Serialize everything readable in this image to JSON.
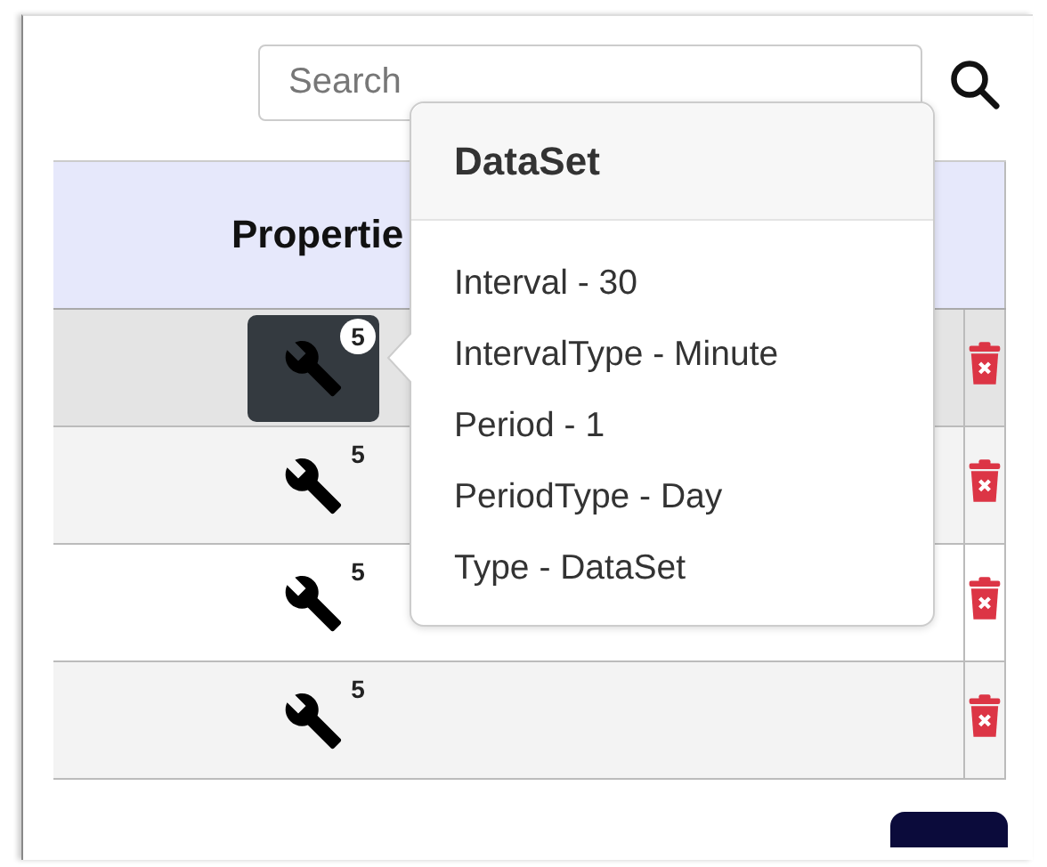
{
  "search": {
    "placeholder": "Search"
  },
  "table": {
    "columns": [
      "Propertie"
    ],
    "rows": [
      {
        "count": "5",
        "selected": true
      },
      {
        "count": "5",
        "selected": false
      },
      {
        "count": "5",
        "selected": false
      },
      {
        "count": "5",
        "selected": false
      }
    ]
  },
  "popover": {
    "title": "DataSet",
    "lines": [
      "Interval - 30",
      "IntervalType - Minute",
      "Period - 1",
      "PeriodType - Day",
      "Type - DataSet"
    ]
  }
}
